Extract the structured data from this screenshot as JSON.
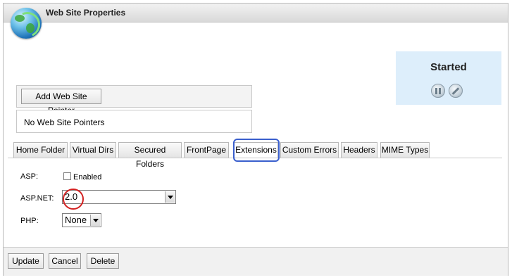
{
  "window": {
    "title": "Web Site Properties"
  },
  "status": {
    "text": "Started",
    "pause_icon": "pause-icon",
    "stop_icon": "stop-icon"
  },
  "pointers": {
    "add_button": "Add Web Site Pointer",
    "empty_text": "No Web Site Pointers"
  },
  "tabs": [
    {
      "label": "Home Folder",
      "active": false
    },
    {
      "label": "Virtual Dirs",
      "active": false
    },
    {
      "label": "Secured Folders",
      "active": false
    },
    {
      "label": "FrontPage",
      "active": false
    },
    {
      "label": "Extensions",
      "active": true
    },
    {
      "label": "Custom Errors",
      "active": false
    },
    {
      "label": "Headers",
      "active": false
    },
    {
      "label": "MIME Types",
      "active": false
    }
  ],
  "extensions": {
    "asp_label": "ASP:",
    "asp_enabled_label": "Enabled",
    "asp_enabled": false,
    "aspnet_label": "ASP.NET:",
    "aspnet_value": "2.0",
    "php_label": "PHP:",
    "php_value": "None"
  },
  "footer": {
    "update": "Update",
    "cancel": "Cancel",
    "delete": "Delete"
  },
  "colors": {
    "status_panel": "#ddeefb",
    "highlight_tab": "#3a5fcd",
    "highlight_value": "#d22020"
  }
}
